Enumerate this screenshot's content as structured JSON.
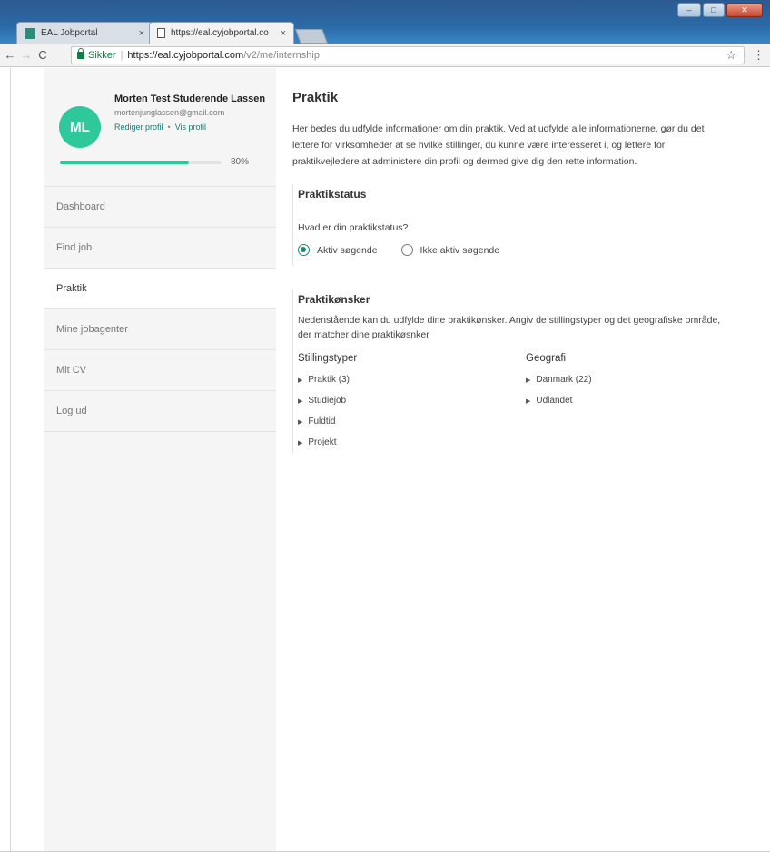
{
  "browser": {
    "tabs": [
      {
        "label": "EAL Jobportal"
      },
      {
        "label": "https://eal.cyjobportal.co"
      }
    ],
    "url": {
      "secure_label": "Sikker",
      "host": "https://eal.cyjobportal.com",
      "path": "/v2/me/internship"
    }
  },
  "profile": {
    "initials": "ML",
    "name": "Morten Test Studerende Lassen",
    "email": "mortenjunglassen@gmail.com",
    "edit_label": "Rediger profil",
    "view_label": "Vis profil",
    "progress_label": "80%",
    "progress_value": 80
  },
  "sidebar": {
    "items": [
      {
        "label": "Dashboard"
      },
      {
        "label": "Find job"
      },
      {
        "label": "Praktik"
      },
      {
        "label": "Mine jobagenter"
      },
      {
        "label": "Mit CV"
      },
      {
        "label": "Log ud"
      }
    ]
  },
  "main": {
    "title": "Praktik",
    "intro": "Her bedes du udfylde informationer om din praktik. Ved at udfylde alle informationerne, gør du det lettere for virksomheder at se hvilke stillinger, du kunne være interesseret i, og lettere for praktikvejledere at administere din profil og dermed give dig den rette information.",
    "status": {
      "title": "Praktikstatus",
      "question": "Hvad er din praktikstatus?",
      "options": [
        {
          "label": "Aktiv søgende",
          "selected": true
        },
        {
          "label": "Ikke aktiv søgende",
          "selected": false
        }
      ]
    },
    "wishes": {
      "title": "Praktikønsker",
      "description": "Nedenstående kan du udfylde dine praktikønsker. Angiv de stillingstyper og det geografiske område, der matcher dine praktikøsnker",
      "job_types": {
        "heading": "Stillingstyper",
        "items": [
          "Praktik (3)",
          "Studiejob",
          "Fuldtid",
          "Projekt"
        ]
      },
      "geography": {
        "heading": "Geografi",
        "items": [
          "Danmark (22)",
          "Udlandet"
        ]
      }
    }
  },
  "colors": {
    "accent": "#2fc79c",
    "link": "#1a7a74",
    "sidebar_bg": "#f5f5f5"
  }
}
